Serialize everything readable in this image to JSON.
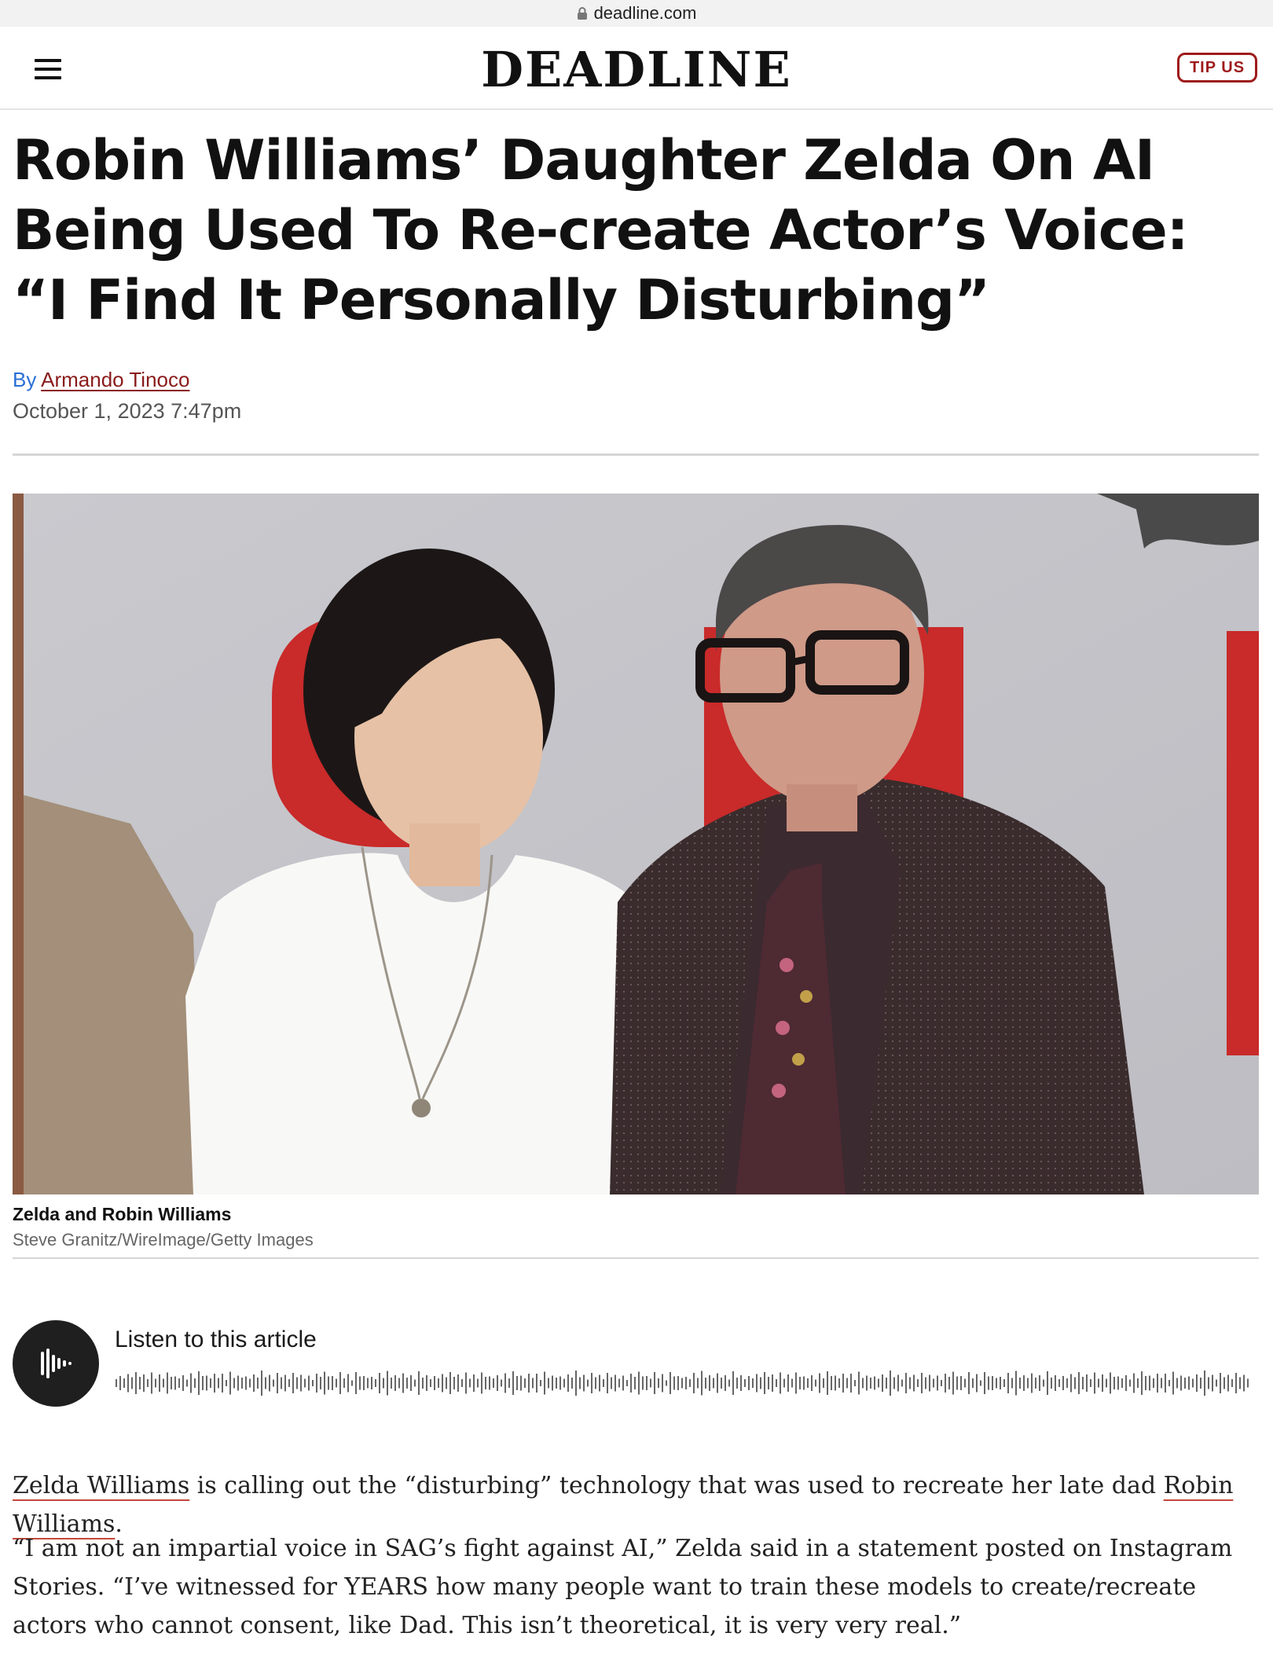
{
  "browser": {
    "url": "deadline.com",
    "lock_icon": "lock-icon"
  },
  "site": {
    "logo": "DEADLINE",
    "menu_icon": "hamburger-menu-icon",
    "tip_label": "TIP US",
    "accent": "#9e1b1b"
  },
  "article": {
    "headline": "Robin Williams’ Daughter Zelda On AI Being Used To Re-create Actor’s Voice: “I Find It Personally Disturbing”",
    "byline_prefix": "By",
    "author": "Armando Tinoco",
    "date": "October 1, 2023 7:47pm",
    "image_caption": "Zelda and Robin Williams",
    "image_credit": "Steve Granitz/WireImage/Getty Images",
    "audio": {
      "label": "Listen to this article",
      "icon": "audio-waveform-play-icon"
    },
    "paragraph1": {
      "link1": "Zelda Williams",
      "mid": " is calling out the “disturbing” technology that was used to recreate her late dad ",
      "link2": "Robin Williams",
      "end": "."
    },
    "paragraph2": "“I am not an impartial voice in SAG’s fight against AI,” Zelda said in a statement posted on Instagram Stories. “I’ve witnessed for YEARS how many people want to train these models to create/recreate actors who cannot consent, like Dad. This isn’t theoretical, it is very very real.”"
  }
}
